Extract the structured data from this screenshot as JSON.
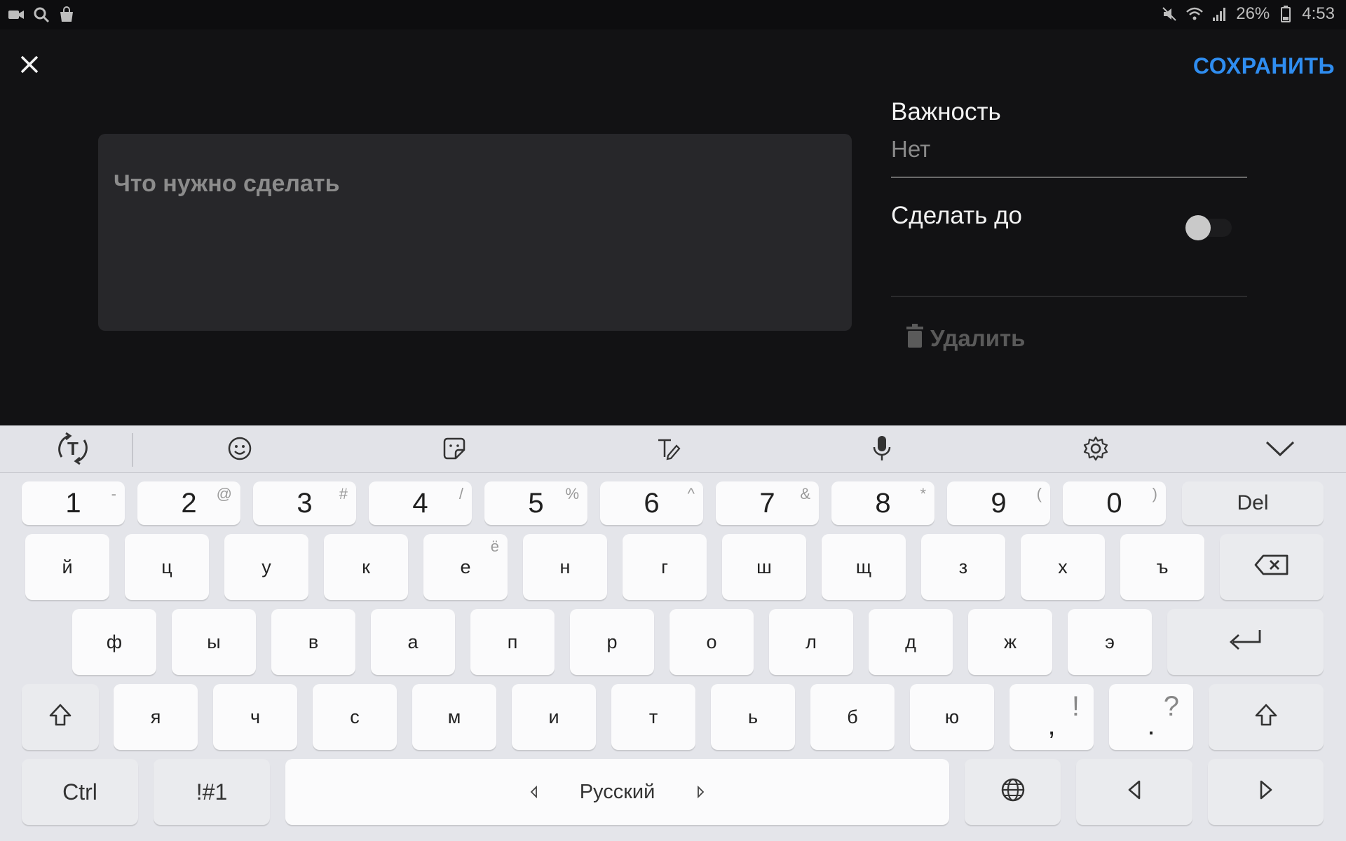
{
  "status_bar": {
    "battery": "26%",
    "time": "4:53"
  },
  "header": {
    "save_label": "СОХРАНИТЬ"
  },
  "task": {
    "placeholder": "Что нужно сделать"
  },
  "details": {
    "importance_title": "Важность",
    "importance_value": "Нет",
    "due_label": "Сделать до",
    "due_enabled": false,
    "delete_label": "Удалить"
  },
  "keyboard": {
    "number_row": [
      {
        "main": "1",
        "sub": "-"
      },
      {
        "main": "2",
        "sub": "@"
      },
      {
        "main": "3",
        "sub": "#"
      },
      {
        "main": "4",
        "sub": "/"
      },
      {
        "main": "5",
        "sub": "%"
      },
      {
        "main": "6",
        "sub": "^"
      },
      {
        "main": "7",
        "sub": "&"
      },
      {
        "main": "8",
        "sub": "*"
      },
      {
        "main": "9",
        "sub": "("
      },
      {
        "main": "0",
        "sub": ")"
      }
    ],
    "del_label": "Del",
    "row1": [
      {
        "main": "й",
        "sub": ""
      },
      {
        "main": "ц",
        "sub": ""
      },
      {
        "main": "у",
        "sub": ""
      },
      {
        "main": "к",
        "sub": ""
      },
      {
        "main": "е",
        "sub": "ё"
      },
      {
        "main": "н",
        "sub": ""
      },
      {
        "main": "г",
        "sub": ""
      },
      {
        "main": "ш",
        "sub": ""
      },
      {
        "main": "щ",
        "sub": ""
      },
      {
        "main": "з",
        "sub": ""
      },
      {
        "main": "х",
        "sub": ""
      },
      {
        "main": "ъ",
        "sub": ""
      }
    ],
    "row2": [
      "ф",
      "ы",
      "в",
      "а",
      "п",
      "р",
      "о",
      "л",
      "д",
      "ж",
      "э"
    ],
    "row3": [
      {
        "main": "я",
        "sub": ""
      },
      {
        "main": "ч",
        "sub": ""
      },
      {
        "main": "с",
        "sub": ""
      },
      {
        "main": "м",
        "sub": ""
      },
      {
        "main": "и",
        "sub": ""
      },
      {
        "main": "т",
        "sub": ""
      },
      {
        "main": "ь",
        "sub": ""
      },
      {
        "main": "б",
        "sub": ""
      },
      {
        "main": "ю",
        "sub": ""
      },
      {
        "main": ",",
        "sub": "!"
      },
      {
        "main": ".",
        "sub": "?"
      }
    ],
    "ctrl_label": "Ctrl",
    "symbols_label": "!#1",
    "space_label": "Русский"
  },
  "icons": [
    "video-icon",
    "search-icon",
    "bag-icon",
    "mute-icon",
    "wifi-icon",
    "signal-icon",
    "battery-icon",
    "close-icon",
    "trash-icon",
    "text-recognition-icon",
    "emoji-icon",
    "sticker-icon",
    "handwriting-icon",
    "microphone-icon",
    "settings-icon",
    "collapse-keyboard-icon",
    "backspace-icon",
    "enter-icon",
    "shift-icon",
    "globe-icon",
    "arrow-left-icon",
    "arrow-right-icon"
  ],
  "colors": {
    "accent": "#2f8df0",
    "background": "#121214",
    "input_background": "#27272a",
    "keyboard_background": "#e4e5ea"
  }
}
